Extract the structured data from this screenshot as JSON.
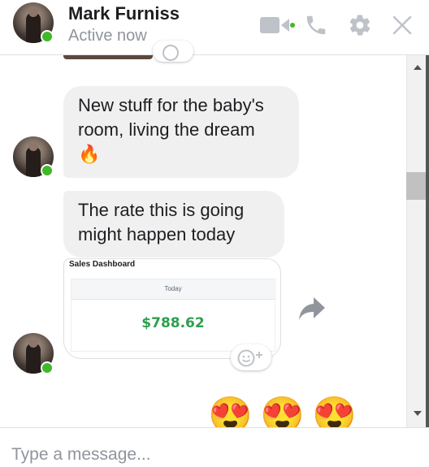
{
  "header": {
    "name": "Mark Furniss",
    "status": "Active now",
    "icons": [
      "video-camera-icon",
      "phone-icon",
      "gear-icon",
      "close-icon"
    ]
  },
  "messages": [
    {
      "text": "New stuff for the baby's room, living the dream",
      "emoji": "🔥"
    },
    {
      "text": "The rate this is going might happen today"
    }
  ],
  "shared_card": {
    "title": "Sales Dashboard",
    "subtitle": "Today",
    "amount": "$788.62"
  },
  "reactions_sent": [
    "😍",
    "😍",
    "😍"
  ],
  "composer": {
    "placeholder": "Type a message..."
  },
  "colors": {
    "online": "#42b72a",
    "amount": "#2e9e4f",
    "bubble": "#f1f0f0",
    "icon": "#bec2c9"
  }
}
